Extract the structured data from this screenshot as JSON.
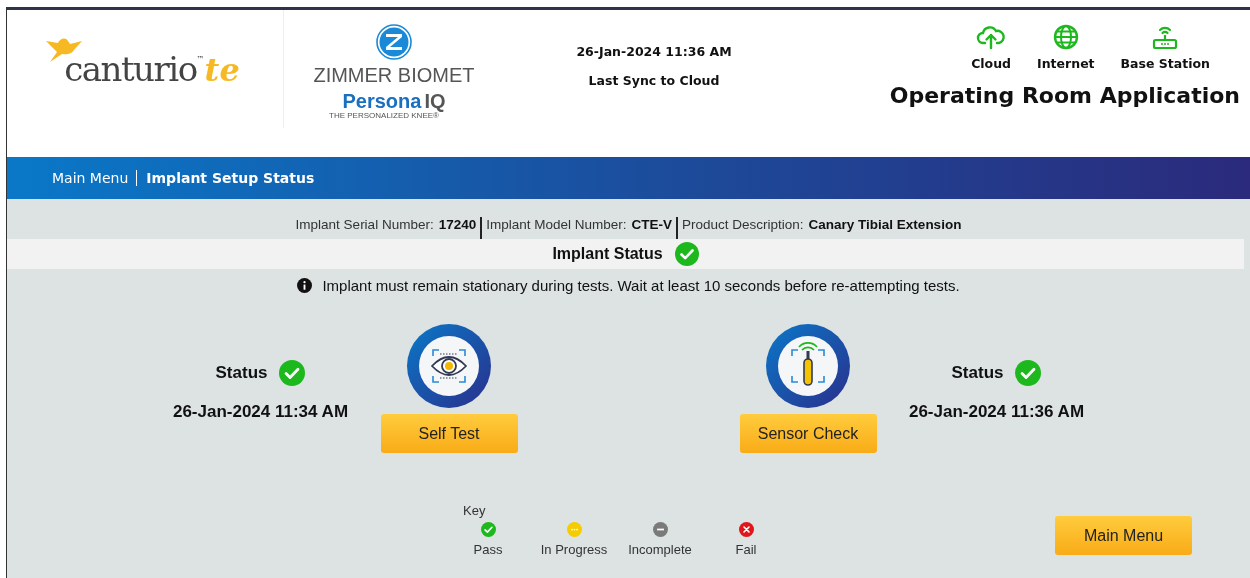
{
  "header": {
    "logo": {
      "word": "canturio",
      "tm": "™",
      "suffix": "te"
    },
    "partner": {
      "name": "ZIMMER BIOMET",
      "product": "Persona",
      "product_suffix": "IQ",
      "tagline": "THE PERSONALIZED KNEE®"
    },
    "sync": {
      "time": "26-Jan-2024 11:36 AM",
      "label": "Last Sync to Cloud"
    },
    "connections": [
      {
        "kind": "cloud",
        "label": "Cloud"
      },
      {
        "kind": "internet",
        "label": "Internet"
      },
      {
        "kind": "station",
        "label": "Base Station"
      }
    ],
    "app_title": "Operating Room Application"
  },
  "breadcrumb": [
    {
      "label": "Main Menu",
      "selected": false
    },
    {
      "label": "Implant Setup Status",
      "selected": true
    }
  ],
  "implant_info": [
    {
      "label": "Implant Serial Number:",
      "value": "17240"
    },
    {
      "label": "Implant Model Number:",
      "value": "CTE-V"
    },
    {
      "label": "Product Description:",
      "value": "Canary Tibial Extension"
    }
  ],
  "implant_status": {
    "label": "Implant Status",
    "kind": "pass"
  },
  "notice": "Implant must remain stationary during tests. Wait at least 10 seconds before re-attempting tests.",
  "tests": [
    {
      "kind": "eye",
      "status": {
        "label": "Status",
        "kind": "pass"
      },
      "time": "26-Jan-2024 11:34 AM",
      "button": "Self Test"
    },
    {
      "kind": "sensor",
      "status": {
        "label": "Status",
        "kind": "pass"
      },
      "time": "26-Jan-2024 11:36 AM",
      "button": "Sensor Check"
    }
  ],
  "key": {
    "title": "Key",
    "items": [
      {
        "kind": "pass",
        "label": "Pass"
      },
      {
        "kind": "in_progress",
        "label": "In Progress"
      },
      {
        "kind": "incomplete",
        "label": "Incomplete"
      },
      {
        "kind": "fail",
        "label": "Fail"
      }
    ]
  },
  "main_menu_button": "Main Menu"
}
